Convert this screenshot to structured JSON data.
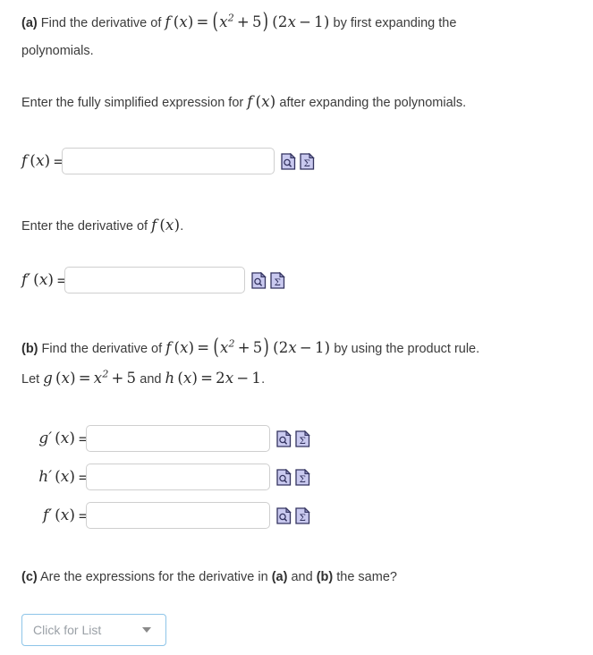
{
  "question": {
    "part_a": {
      "marker": "(a)",
      "text_before": "Find the derivative of",
      "formula": "f (x) = (x² + 5) (2x − 1)",
      "text_after": "by first expanding the",
      "line2": "polynomials.",
      "instruction_1_before": "Enter the fully simplified expression for",
      "instruction_1_math": "f (x)",
      "instruction_1_after": "after expanding the polynomials.",
      "instruction_2_before": "Enter the derivative of",
      "instruction_2_math": "f (x)",
      "instruction_2_after": "."
    },
    "part_b": {
      "marker": "(b)",
      "text_before": "Find the derivative of",
      "formula": "f (x) = (x² + 5) (2x − 1)",
      "text_after": "by using the product rule.",
      "let_before": "Let",
      "let_g": "g (x) = x² + 5",
      "let_and": "and",
      "let_h": "h (x) = 2x − 1",
      "let_end": "."
    },
    "part_c": {
      "marker": "(c)",
      "text": "Are the expressions for the derivative in (a) and (b) the same?",
      "ref_a": "(a)",
      "ref_b": "(b)",
      "text_1": "Are the expressions for the derivative in",
      "text_2": "and",
      "text_3": "the same?"
    }
  },
  "answers": {
    "fx": {
      "label": "f (x)",
      "equals": "=",
      "value": "",
      "placeholder": ""
    },
    "fprime_a": {
      "label": "f' (x)",
      "equals": "=",
      "value": "",
      "placeholder": ""
    },
    "gprime": {
      "label": "g' (x)",
      "equals": "=",
      "value": "",
      "placeholder": ""
    },
    "hprime": {
      "label": "h' (x)",
      "equals": "=",
      "value": "",
      "placeholder": ""
    },
    "fprime_b": {
      "label": "f' (x)",
      "equals": "=",
      "value": "",
      "placeholder": ""
    }
  },
  "icons": {
    "preview": "preview-document-icon",
    "equation_editor": "equation-editor-sigma-icon",
    "sigma_glyph": "Σ",
    "fill_color": "#c9c9ef",
    "border_color": "#3a3a6e",
    "fold_color": "#8f8fbf"
  },
  "dropdown": {
    "placeholder": "Click for List",
    "caret": "chevron-down-icon",
    "border_color": "#8ec5e8",
    "text_color": "#9aa0a6"
  },
  "theme": {
    "text_color": "#3b3b3b",
    "math_color": "#2b2b2b",
    "input_border": "#cfcfcf",
    "background": "#ffffff"
  }
}
